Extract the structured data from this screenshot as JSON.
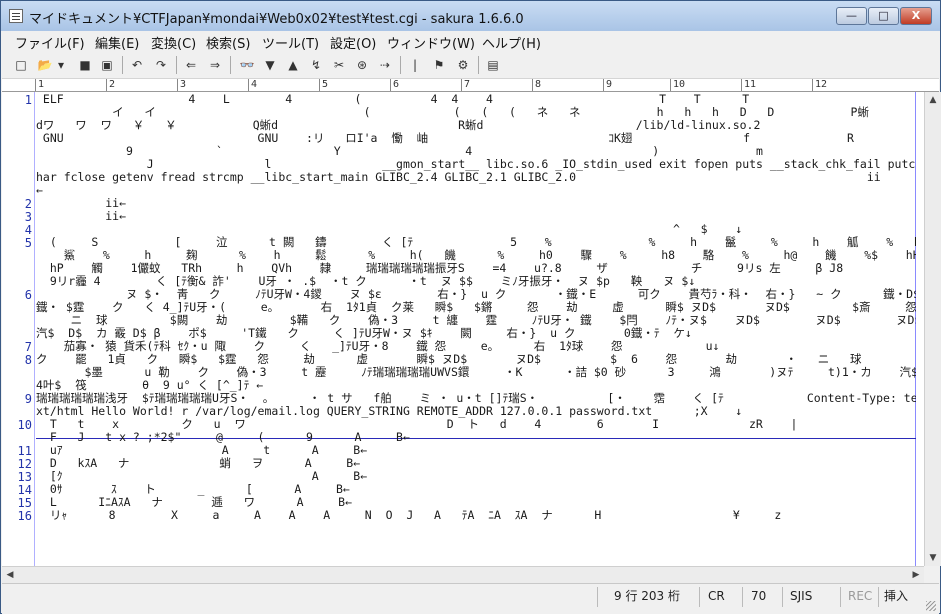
{
  "title": "マイドキュメント¥CTFJapan¥mondai¥Web0x02¥test¥test.cgi - sakura 1.6.6.0",
  "window_buttons": {
    "minimize": "—",
    "maximize": "□",
    "close": "X"
  },
  "menu": [
    "ファイル(F)",
    "編集(E)",
    "変換(C)",
    "検索(S)",
    "ツール(T)",
    "設定(O)",
    "ウィンドウ(W)",
    "ヘルプ(H)"
  ],
  "toolbar_icons": [
    "new-file-icon",
    "open-file-icon",
    "dropdown-icon",
    "save-icon",
    "save-all-icon",
    "undo-icon",
    "redo-icon",
    "back-icon",
    "forward-icon",
    "search-icon",
    "search-next-icon",
    "search-prev-icon",
    "replace-icon",
    "grep-icon",
    "mark-icon",
    "jump-icon",
    "tag-icon",
    "outline-icon",
    "settings-icon",
    "type-settings-icon"
  ],
  "toolbar_glyphs": [
    "□",
    "📂",
    "▾",
    "■",
    "▣",
    "↶",
    "↷",
    "⇐",
    "⇒",
    "👓",
    "▼",
    "▲",
    "↯",
    "✂",
    "⊛",
    "⇢",
    "|",
    "⚑",
    "⚙",
    "▤"
  ],
  "ruler_labels": [
    "1",
    "2",
    "3",
    "4",
    "5",
    "6",
    "7",
    "8",
    "9",
    "10",
    "11",
    "12"
  ],
  "lines": [
    {
      "num": "1",
      "text": " ELF                  4    L        4         (          4  4    4                        T    T      T"
    },
    {
      "num": "",
      "text": "           イ   イ                              (            (   (   (   ネ   ネ           h   h   h   D   D           P蜥"
    },
    {
      "num": "",
      "text": "dワ   ワ  ワ   ￥   ￥           Q蜥d                          R蜥d                      /lib/ld-linux.so.2"
    },
    {
      "num": "",
      "text": " GNU                            GNU    :リ   ロI'a  慟  岫                          ｺK翅                f              R"
    },
    {
      "num": "",
      "text": "             9            `                Y                  4                          )              m"
    },
    {
      "num": "",
      "text": "                J                l                __gmon_start__ libc.so.6 _IO_stdin_used exit fopen puts __stack_chk_fail putc"
    },
    {
      "num": "",
      "text": "har fclose getenv fread strcmp __libc_start_main GLIBC_2.4 GLIBC_2.1 GLIBC_2.0                                          ii"
    },
    {
      "num": "",
      "text": "←"
    },
    {
      "num": "2",
      "text": "          ii←"
    },
    {
      "num": "3",
      "text": "          ii←"
    },
    {
      "num": "4",
      "text": "                                                                                            ^   $    ↓"
    },
    {
      "num": "5",
      "text": "  (     S           [     泣      t 闕   鑄        く [ﾃ              5    %              %     h    鬣     %     h    觚    %   h"
    },
    {
      "num": "",
      "text": "    鯊    %     h     麹      %    h     鬆      %     h(   饑      %     h0    驟    %     h8    駱    %     h@    饑    %$    hH    餘    %("
    },
    {
      "num": "",
      "text": "  hP    觸    1儼蚊   TRh     h    QVh    隸     瑞瑞瑞瑞瑞瑞振牙S    =4    u?.8     ザ            チ     9リs 左     β J8"
    },
    {
      "num": "",
      "text": "  9リr霾 4        く [ﾃ衡& 詐'    U牙 ・ .$  ・t ク      ・t  ヌ $$    ミﾉ牙振牙・  ヌ $p   鞅   ヌ $↓"
    },
    {
      "num": "6",
      "text": "             ヌ $・  靑   ク     ﾉﾃU牙W・4鑁    ヌ $ε        右・}  u ク       ・鐡・E      可ク    貴芍ﾗ・科・  右・}   ~ ク      鐡・D$"
    },
    {
      "num": "",
      "text": "鐡・ $霆    ク   く 4_]ﾃU牙・(     e。      右  1ﾀ1貞  ク莱   瞬$   $鏘     怨    劫     虚      瞬$ ヌD$       ヌD$         $斎     怨       劫"
    },
    {
      "num": "",
      "text": "     ニ  球         $闕    劫         $鞴   ク    偽・3     t 纏    霆     ﾉﾃU牙・ 鐡    $閂    ﾉﾃ・ヌ$    ヌD$        ヌD$        ヌD$        ネ$"
    },
    {
      "num": "",
      "text": "汽$  D$  カ 霰 D$ β    ポ$     'T鐵   ク     く ]ﾃU牙W・ヌ $ｷ    闕     右・}  u ク       0鐡・ﾃ  ケ↓"
    },
    {
      "num": "7",
      "text": "    茄寡・ 猿 貨禾(ﾃ科 ｾｸ・u 陬    ク     く   _]ﾃU牙・8    鐡 怨     e。     右  1ﾀ球    怨            u↓"
    },
    {
      "num": "8",
      "text": "ク    罷   1貞   ク   瞬$   $霆   怨     劫      虚       瞬$ ヌD$       ヌD$          $  6    怨       劫       ・   ニ   球          $頤   球       叶$  劫"
    },
    {
      "num": "",
      "text": "       $墨      u 勒    ク    偽・3     t 靂     ﾉﾃ瑞瑞瑞瑞瑞UWVS鐶     ・K      ・詰 $0 砂      3     鴻       )ヌﾃ     t)1・カ    汽$8 ,$叶$ 汽$"
    },
    {
      "num": "",
      "text": "4叶$  筏        θ  9 u° く [^_]ﾃ ←"
    },
    {
      "num": "9",
      "text": "瑞瑞瑞瑞瑞瑞浅牙  $ﾃ瑞瑞瑞瑞瑞U牙S・  。     ・ t サ   f舶    ミ ・ u・t []ﾃ瑞S・          [・    霑    く [ﾃ            Content-Type: te"
    },
    {
      "num": "",
      "text": "xt/html Hello World! r /var/log/email.log QUERY_STRING REMOTE_ADDR 127.0.0.1 password.txt      ;X    ↓"
    },
    {
      "num": "10",
      "text": "  T   t    x         ク   u  ワ                             D  ト   d    4        6       I             zR    |                   リ   タ"
    },
    {
      "num": "",
      "text": "  F   J   t x ? ;*2$\"     @     (      9      A     B←"
    },
    {
      "num": "11",
      "text": "  uｱ                       A     t      A     B←"
    },
    {
      "num": "12",
      "text": "  D   kｽA   ナ             蛸   ヲ      A     B←"
    },
    {
      "num": "13",
      "text": "  [ｸ                                    A     B←"
    },
    {
      "num": "14",
      "text": "  0ｻ       ｽ    ト      _      [      A     B←"
    },
    {
      "num": "15",
      "text": "  L      IﾆAｽA   ナ       逓   ワ      A     B←"
    },
    {
      "num": "16",
      "text": "  リｬ      8        X     a     A    A    A     N  O  J   A   ﾃA  ﾆA  ｽA  ナ      H                   ¥     z"
    }
  ],
  "status": {
    "position": "9 行 203 桁",
    "eol": "CR",
    "code": "70",
    "encoding": "SJIS",
    "rec": "REC",
    "mode": "挿入"
  }
}
